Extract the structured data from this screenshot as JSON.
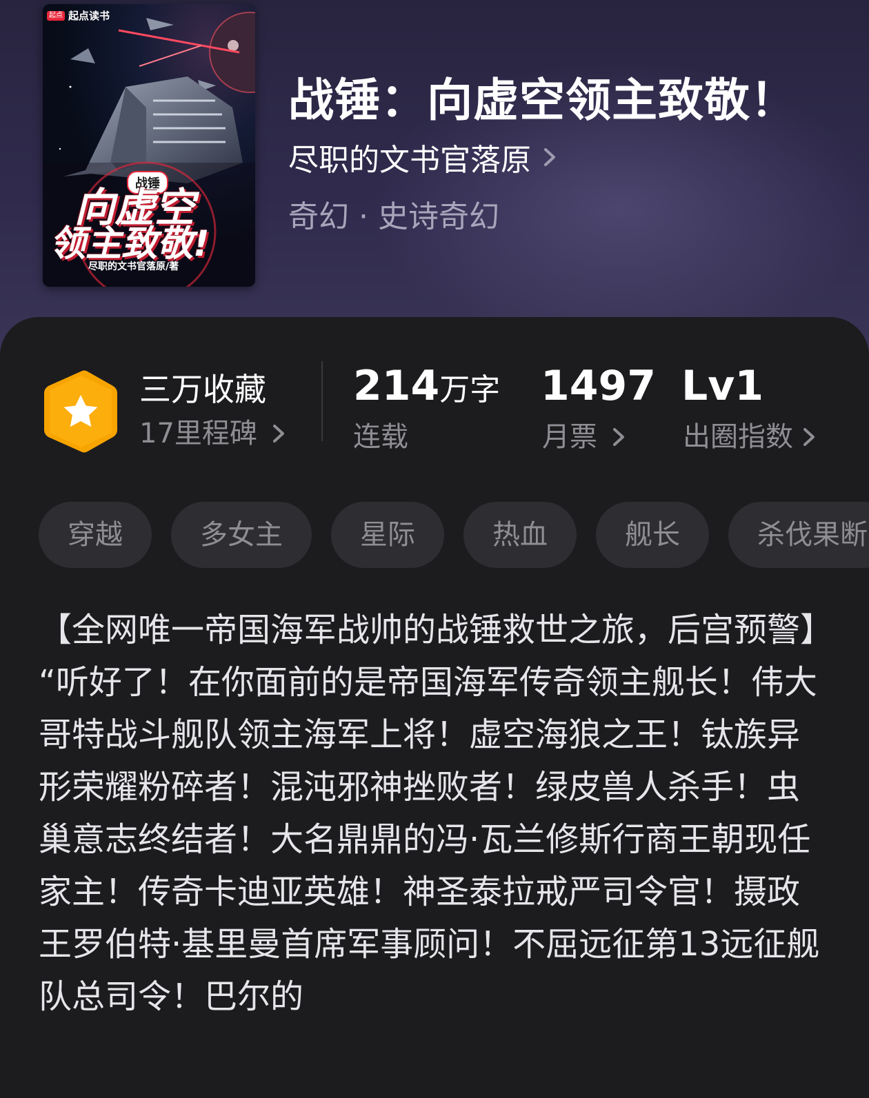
{
  "book": {
    "title": "战锤：向虚空领主致敬！",
    "author": "尽职的文书官落原",
    "genre": "奇幻 · 史诗奇幻"
  },
  "cover": {
    "publisher": "起点读书",
    "publisher_badge": "起点",
    "small_title": "战锤",
    "title_line1": "向虚空",
    "title_line2": "领主致敬!",
    "credit": "尽职的文书官落原/著"
  },
  "stats": {
    "collect": {
      "main": "三万收藏",
      "sub": "17里程碑"
    },
    "words": {
      "value": "214",
      "unit": "万字",
      "label": "连载"
    },
    "tickets": {
      "value": "1497",
      "label": "月票"
    },
    "influence": {
      "value": "Lv1",
      "label": "出圈指数"
    }
  },
  "tags": [
    "穿越",
    "多女主",
    "星际",
    "热血",
    "舰长",
    "杀伐果断"
  ],
  "intro": {
    "headline": "【全网唯一帝国海军战帅的战锤救世之旅，后宫预警】",
    "body": "“听好了！在你面前的是帝国海军传奇领主舰长！伟大哥特战斗舰队领主海军上将！虚空海狼之王！钛族异形荣耀粉碎者！混沌邪神挫败者！绿皮兽人杀手！虫巢意志终结者！大名鼎鼎的冯·瓦兰修斯行商王朝现任家主！传奇卡迪亚英雄！神圣泰拉戒严司令官！摄政王罗伯特·基里曼首席军事顾问！不屈远征第13远征舰队总司令！巴尔的"
  },
  "colors": {
    "header_bg": "#2d2947",
    "card_bg": "#1c1c1f",
    "tag_bg": "#2e2e32",
    "muted_text": "#8e8e93",
    "genre_text": "#a9a5bb",
    "badge_orange": "#f7a400",
    "cover_red": "#e8283c"
  },
  "icons": {
    "author_chevron": "chevron-right-icon",
    "milestone_badge": "star-hexagon-icon"
  }
}
